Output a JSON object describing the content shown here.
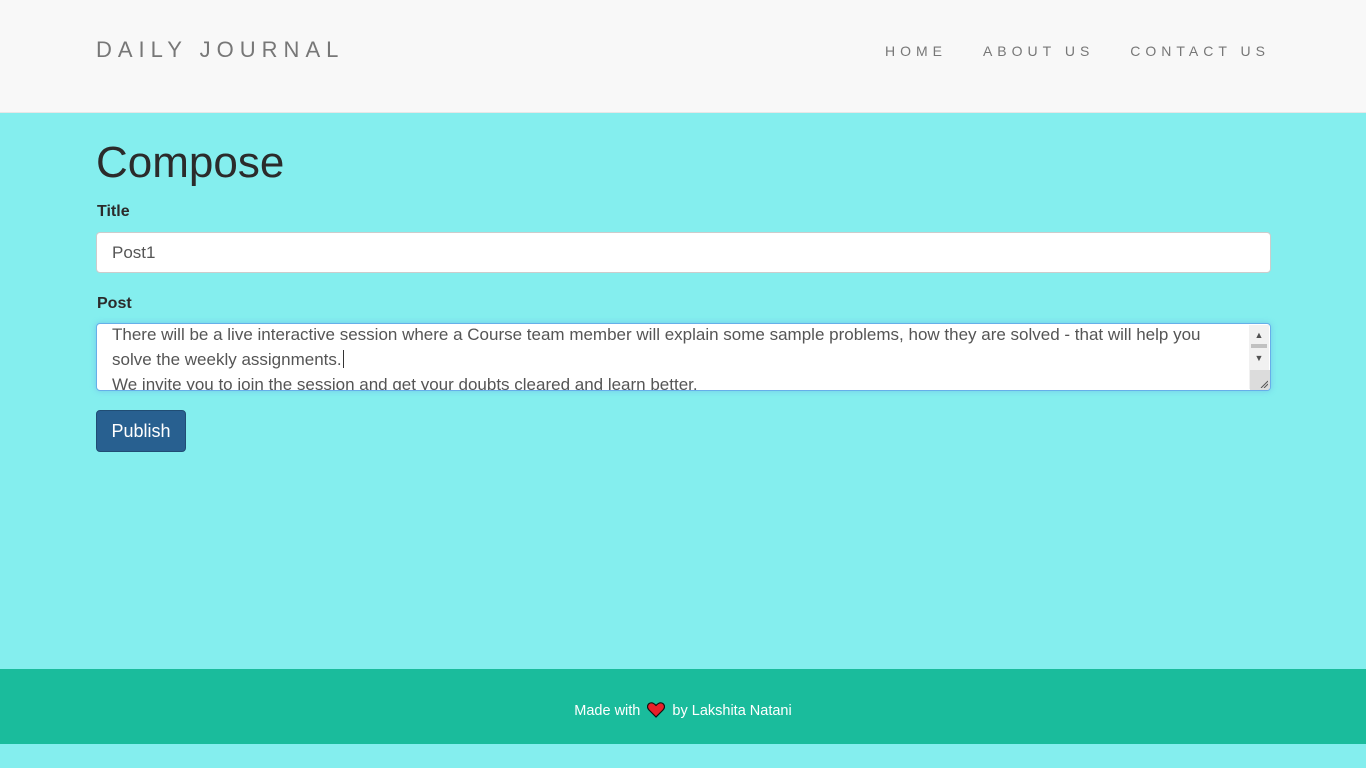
{
  "header": {
    "brand": "DAILY JOURNAL",
    "nav": [
      {
        "label": "HOME"
      },
      {
        "label": "ABOUT US"
      },
      {
        "label": "CONTACT US"
      }
    ]
  },
  "main": {
    "heading": "Compose",
    "title_label": "Title",
    "title_value": "Post1",
    "post_label": "Post",
    "post_lines": [
      "There will be a live interactive session where a Course team member will explain some sample problems, how they are solved - that will help you solve the weekly assignments.",
      "We invite you to join the session and get your doubts cleared and learn better."
    ],
    "publish_label": "Publish"
  },
  "footer": {
    "prefix": "Made with",
    "suffix": "by Lakshita Natani",
    "heart_icon": "heart-icon"
  },
  "colors": {
    "page_background": "#84eeee",
    "navbar_background": "#f8f8f8",
    "footer_background": "#1abc9c",
    "publish_button": "#286090",
    "heart": "#e8202a"
  }
}
